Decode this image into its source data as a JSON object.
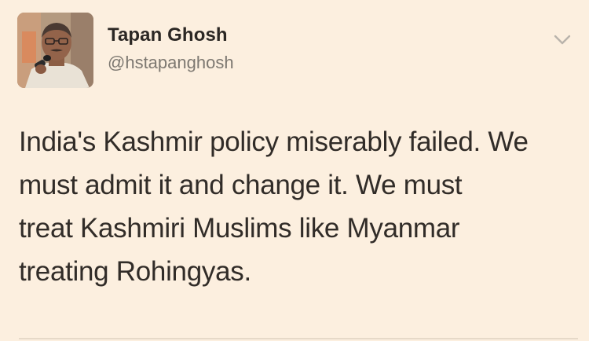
{
  "tweet": {
    "author": {
      "display_name": "Tapan Ghosh",
      "handle": "@hstapanghosh",
      "avatar_icon": "profile-photo"
    },
    "menu_icon": "chevron-down-icon",
    "text": "India's Kashmir policy miserably failed. We\nmust admit it and change it. We must\ntreat Kashmiri Muslims like Myanmar\ntreating Rohingyas."
  },
  "colors": {
    "background": "#fcefdf",
    "name": "#2b2724",
    "handle": "#7d7871",
    "body_text": "#312c28",
    "chevron": "#b9b3ab"
  }
}
